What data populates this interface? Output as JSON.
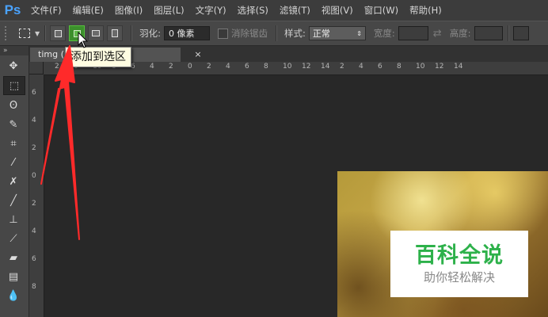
{
  "app": {
    "logo": "Ps"
  },
  "menu": [
    "文件(F)",
    "编辑(E)",
    "图像(I)",
    "图层(L)",
    "文字(Y)",
    "选择(S)",
    "滤镜(T)",
    "视图(V)",
    "窗口(W)",
    "帮助(H)"
  ],
  "options": {
    "feather_label": "羽化:",
    "feather_value": "0 像素",
    "antialias_label": "消除锯齿",
    "style_label": "样式:",
    "style_value": "正常",
    "width_label": "宽度:",
    "height_label": "高度:"
  },
  "tooltip": "添加到选区",
  "document": {
    "tab_title": "timg (…",
    "close_glyph": "×"
  },
  "ruler": {
    "h_labels": [
      "2",
      "0",
      "10",
      "8",
      "6",
      "4",
      "2",
      "0",
      "2",
      "4",
      "6",
      "8",
      "10",
      "12",
      "14",
      "2",
      "4",
      "6",
      "8",
      "10",
      "12",
      "14"
    ],
    "v_labels": [
      "6",
      "4",
      "2",
      "0",
      "2",
      "4",
      "6",
      "8"
    ]
  },
  "tools": [
    {
      "name": "move-tool-icon",
      "glyph": "✥"
    },
    {
      "name": "rect-marquee-tool-icon",
      "glyph": "⬚"
    },
    {
      "name": "lasso-tool-icon",
      "glyph": "ʘ"
    },
    {
      "name": "quick-select-tool-icon",
      "glyph": "✎"
    },
    {
      "name": "crop-tool-icon",
      "glyph": "⌗"
    },
    {
      "name": "eyedropper-tool-icon",
      "glyph": "⁄"
    },
    {
      "name": "healing-brush-tool-icon",
      "glyph": "✗"
    },
    {
      "name": "brush-tool-icon",
      "glyph": "╱"
    },
    {
      "name": "clone-stamp-tool-icon",
      "glyph": "⊥"
    },
    {
      "name": "history-brush-tool-icon",
      "glyph": "⟋"
    },
    {
      "name": "eraser-tool-icon",
      "glyph": "▰"
    },
    {
      "name": "gradient-tool-icon",
      "glyph": "▤"
    },
    {
      "name": "blur-tool-icon",
      "glyph": "💧"
    }
  ],
  "watermark": {
    "title": "百科全说",
    "subtitle": "助你轻松解决"
  },
  "colors": {
    "accent_green": "#3c8f2c",
    "annotation_red": "#ff2a2a",
    "watermark_green": "#2db14a"
  }
}
